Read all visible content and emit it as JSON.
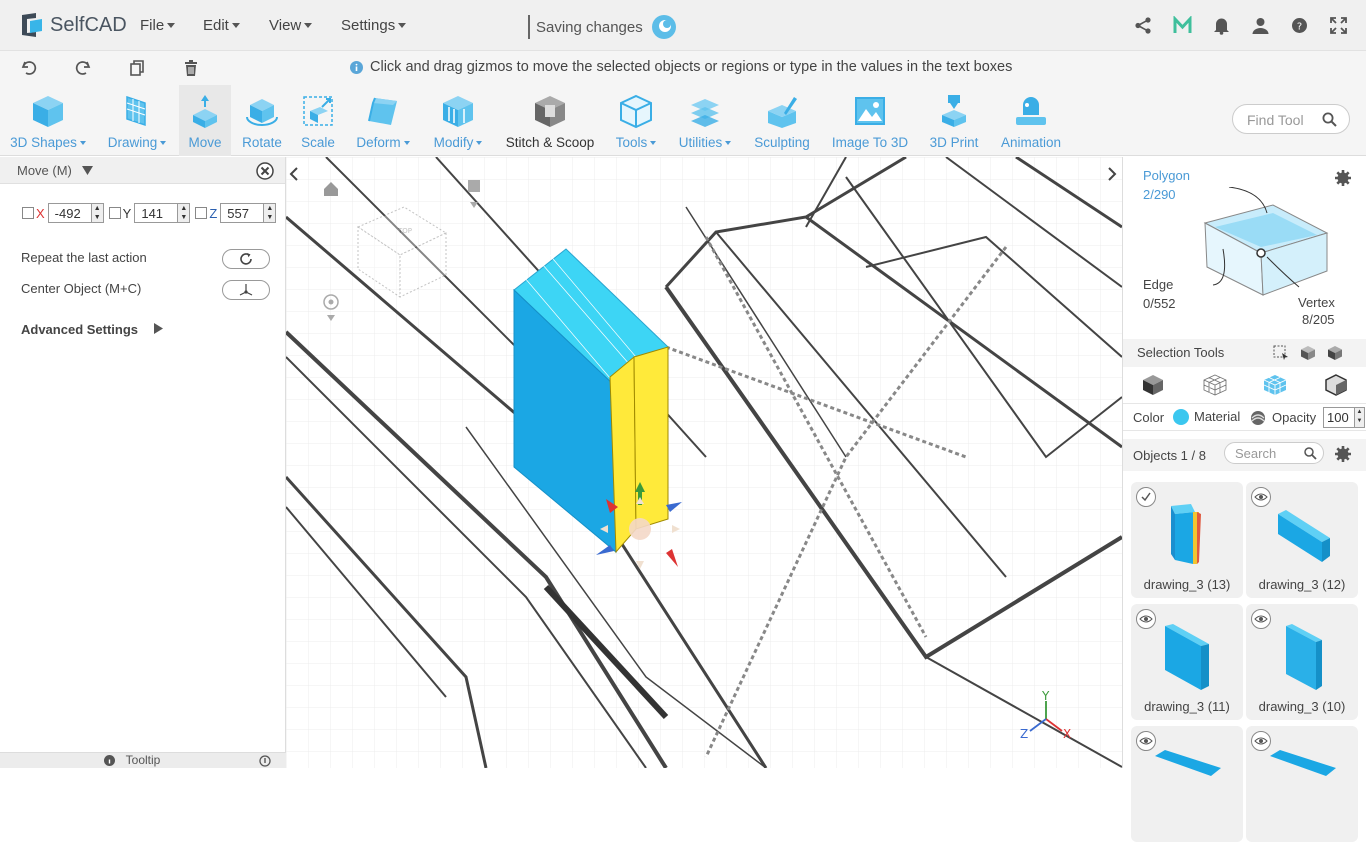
{
  "app": {
    "name": "SelfCAD"
  },
  "menu": [
    "File",
    "Edit",
    "View",
    "Settings"
  ],
  "status": {
    "saving": "Saving changes"
  },
  "hint": "Click and drag gizmos to move the selected objects or regions or type in the values in the text boxes",
  "tools": [
    {
      "label": "3D Shapes"
    },
    {
      "label": "Drawing"
    },
    {
      "label": "Move"
    },
    {
      "label": "Rotate"
    },
    {
      "label": "Scale"
    },
    {
      "label": "Deform"
    },
    {
      "label": "Modify"
    },
    {
      "label": "Stitch & Scoop"
    },
    {
      "label": "Tools"
    },
    {
      "label": "Utilities"
    },
    {
      "label": "Sculpting"
    },
    {
      "label": "Image To 3D"
    },
    {
      "label": "3D Print"
    },
    {
      "label": "Animation"
    }
  ],
  "find_tool": "Find Tool",
  "left_panel": {
    "title": "Move (M)",
    "x_label": "X",
    "x": "-492",
    "y_label": "Y",
    "y": "141",
    "z_label": "Z",
    "z": "557",
    "repeat": "Repeat the last action",
    "center": "Center Object (M+C)",
    "advanced": "Advanced Settings",
    "tooltip": "Tooltip"
  },
  "cube_face": "TOP",
  "axes": {
    "x": "X",
    "y": "Y",
    "z": "Z"
  },
  "right_panel": {
    "polygon_label": "Polygon",
    "polygon_count": "2/290",
    "edge_label": "Edge",
    "edge_count": "0/552",
    "vertex_label": "Vertex",
    "vertex_count": "8/205",
    "selection_tools": "Selection Tools",
    "color": "Color",
    "color_value": "#3bc7ef",
    "material": "Material",
    "opacity": "Opacity",
    "opacity_value": "100",
    "objects": "Objects 1 / 8",
    "search": "Search"
  },
  "objects": [
    {
      "name": "drawing_3 (13)"
    },
    {
      "name": "drawing_3 (12)"
    },
    {
      "name": "drawing_3 (11)"
    },
    {
      "name": "drawing_3 (10)"
    },
    {
      "name": ""
    },
    {
      "name": ""
    }
  ]
}
